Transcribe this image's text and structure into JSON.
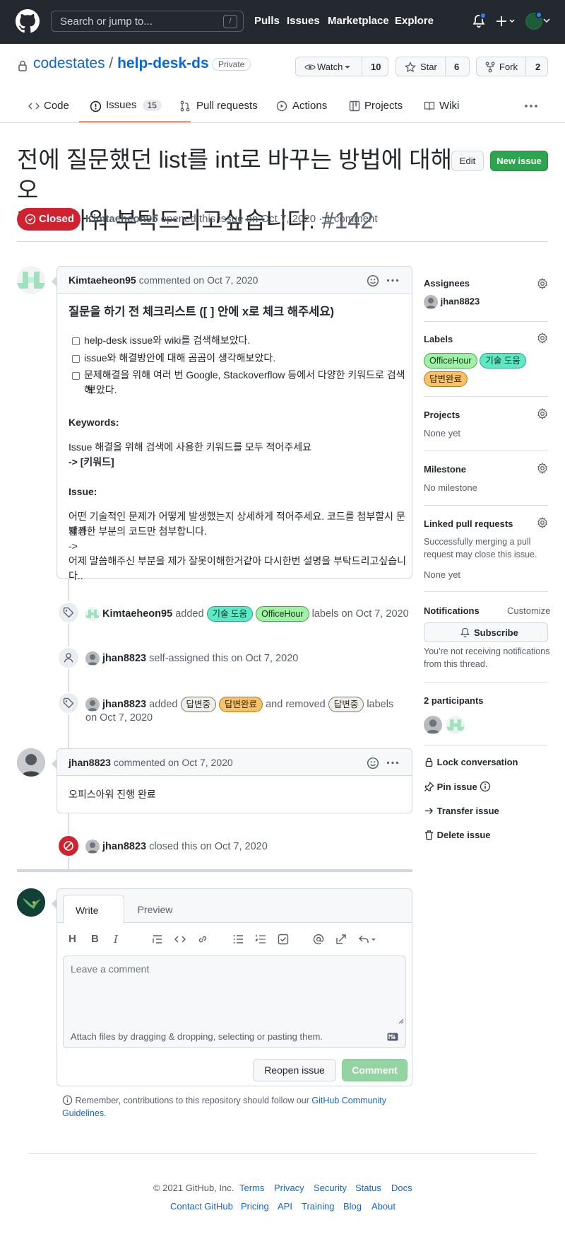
{
  "header": {
    "search_placeholder": "Search or jump to...",
    "slash": "/",
    "nav": [
      "Pulls",
      "Issues",
      "Marketplace",
      "Explore"
    ]
  },
  "repo": {
    "owner": "codestates",
    "separator": "/",
    "name": "help-desk-ds",
    "visibility": "Private",
    "watch_label": "Watch",
    "watch_count": "10",
    "star_label": "Star",
    "star_count": "6",
    "fork_label": "Fork",
    "fork_count": "2"
  },
  "tabs": {
    "code": "Code",
    "issues": "Issues",
    "issues_count": "15",
    "pulls": "Pull requests",
    "actions": "Actions",
    "projects": "Projects",
    "wiki": "Wiki"
  },
  "issue": {
    "title_line1": "전에 질문했던 list를 int로 바꾸는 방법에 대해 오",
    "title_line2": "피스 아워 부탁드리고싶습니다.",
    "number": "#142",
    "edit_label": "Edit",
    "new_issue_label": "New issue",
    "state": "Closed",
    "author": "Kimtaeheon95",
    "meta_text": "opened this issue on Oct 7, 2020 · 1 comment"
  },
  "first_comment": {
    "author": "Kimtaeheon95",
    "meta": "commented on Oct 7, 2020",
    "heading": "질문을 하기 전 체크리스트 ([ ] 안에 x로 체크 해주세요)",
    "checklist": [
      "help-desk issue와 wiki를 검색해보았다.",
      "issue와 해결방안에 대해 곰곰이 생각해보았다.",
      "문제해결을 위해 여러 번 Google, Stackoverflow 등에서 다양한 키워드로 검색해",
      "보았다."
    ],
    "keywords_heading": "Keywords:",
    "keywords_text": "Issue 해결을 위해 검색에 사용한 키워드를 모두 적어주세요",
    "keywords_arrow": "-> [키워드]",
    "issue_heading": "Issue:",
    "issue_text1": "어떤 기술적인 문제가 어떻게 발생했는지 상세하게 적어주세요. 코드를 첨부할시 문제가",
    "issue_text2": "발생한 부분의 코드만 첨부합니다.",
    "issue_text3": "->",
    "issue_text4": "어제 말씀해주신 부분을 제가 잘못이해한거같아 다시한번 설명을 부탁드리고싶습니다.."
  },
  "timeline": {
    "ev1_user": "Kimtaeheon95",
    "ev1_added": "added",
    "ev1_labels": "labels on Oct 7, 2020",
    "ev2_user": "jhan8823",
    "ev2_text": "self-assigned this on Oct 7, 2020",
    "ev3_user": "jhan8823",
    "ev3_added": "added",
    "ev3_removed": "and removed",
    "ev3_labels": "labels",
    "ev3_date": "on Oct 7, 2020",
    "ev4_user": "jhan8823",
    "ev4_text": "closed this on Oct 7, 2020"
  },
  "labels": {
    "gisul": "기술 도움",
    "officehour": "OfficeHour",
    "dapbyeonjung": "답변중",
    "dapbyeonwanryo": "답변완료"
  },
  "second_comment": {
    "author": "jhan8823",
    "meta": "commented on Oct 7, 2020",
    "body": "오피스아워 진행 완료"
  },
  "editor": {
    "write_tab": "Write",
    "preview_tab": "Preview",
    "placeholder": "Leave a comment",
    "attach_text": "Attach files by dragging & dropping, selecting or pasting them.",
    "reopen_label": "Reopen issue",
    "comment_label": "Comment",
    "remember_text": "Remember, contributions to this repository should follow our",
    "guidelines_line1": "GitHub Community",
    "guidelines_line2": "Guidelines",
    "period": "."
  },
  "sidebar": {
    "assignees_title": "Assignees",
    "assignee": "jhan8823",
    "labels_title": "Labels",
    "projects_title": "Projects",
    "projects_value": "None yet",
    "milestone_title": "Milestone",
    "milestone_value": "No milestone",
    "linked_title": "Linked pull requests",
    "linked_text1": "Successfully merging a pull",
    "linked_text2": "request may close this issue.",
    "linked_value": "None yet",
    "notifications_title": "Notifications",
    "customize": "Customize",
    "subscribe": "Subscribe",
    "notif_text1": "You're not receiving notifications",
    "notif_text2": "from this thread.",
    "participants": "2 participants",
    "lock": "Lock conversation",
    "pin": "Pin issue",
    "transfer": "Transfer issue",
    "delete": "Delete issue"
  },
  "footer": {
    "copyright": "© 2021 GitHub, Inc.",
    "row1": [
      "Terms",
      "Privacy",
      "Security",
      "Status",
      "Docs"
    ],
    "row2": [
      "Contact GitHub",
      "Pricing",
      "API",
      "Training",
      "Blog",
      "About"
    ]
  },
  "colors": {
    "header_bg": "#24292f",
    "link": "#0969da",
    "closed_red": "#cf222e",
    "new_issue_green": "#2da44e",
    "tab_underline": "#fd8c73"
  },
  "icons": [
    "github-logo-icon",
    "bell-icon",
    "plus-icon",
    "lock-icon",
    "eye-icon",
    "star-icon",
    "fork-icon",
    "code-icon",
    "issue-icon",
    "pull-request-icon",
    "play-icon",
    "table-icon",
    "book-icon",
    "kebab-icon",
    "smiley-icon",
    "tag-icon",
    "person-icon",
    "gear-icon",
    "pin-icon",
    "arrow-right-icon",
    "trash-icon",
    "markdown-icon"
  ]
}
